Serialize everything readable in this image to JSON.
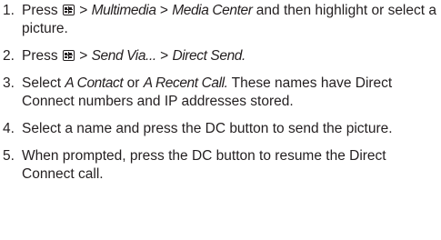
{
  "steps": [
    {
      "number": "1.",
      "press": "Press ",
      "sep1": " > ",
      "menu1": "Multimedia",
      "sep2": " > ",
      "menu2": "Media Center",
      "rest": " and then highlight or select a picture."
    },
    {
      "number": "2.",
      "press": "Press ",
      "sep1": " > ",
      "menu1": "Send Via...",
      "sep2": " > ",
      "menu2": "Direct Send."
    },
    {
      "number": "3.",
      "select": "Select ",
      "option1": "A Contact",
      "or": " or ",
      "option2": "A Recent Call.",
      "rest": " These names have Direct Connect numbers and IP addresses stored."
    },
    {
      "number": "4.",
      "text": "Select a name and press the DC button to send the picture."
    },
    {
      "number": "5.",
      "text": "When prompted, press the DC button to resume the Direct Connect call."
    }
  ],
  "icons": {
    "menu_key": "menu-key-icon"
  }
}
